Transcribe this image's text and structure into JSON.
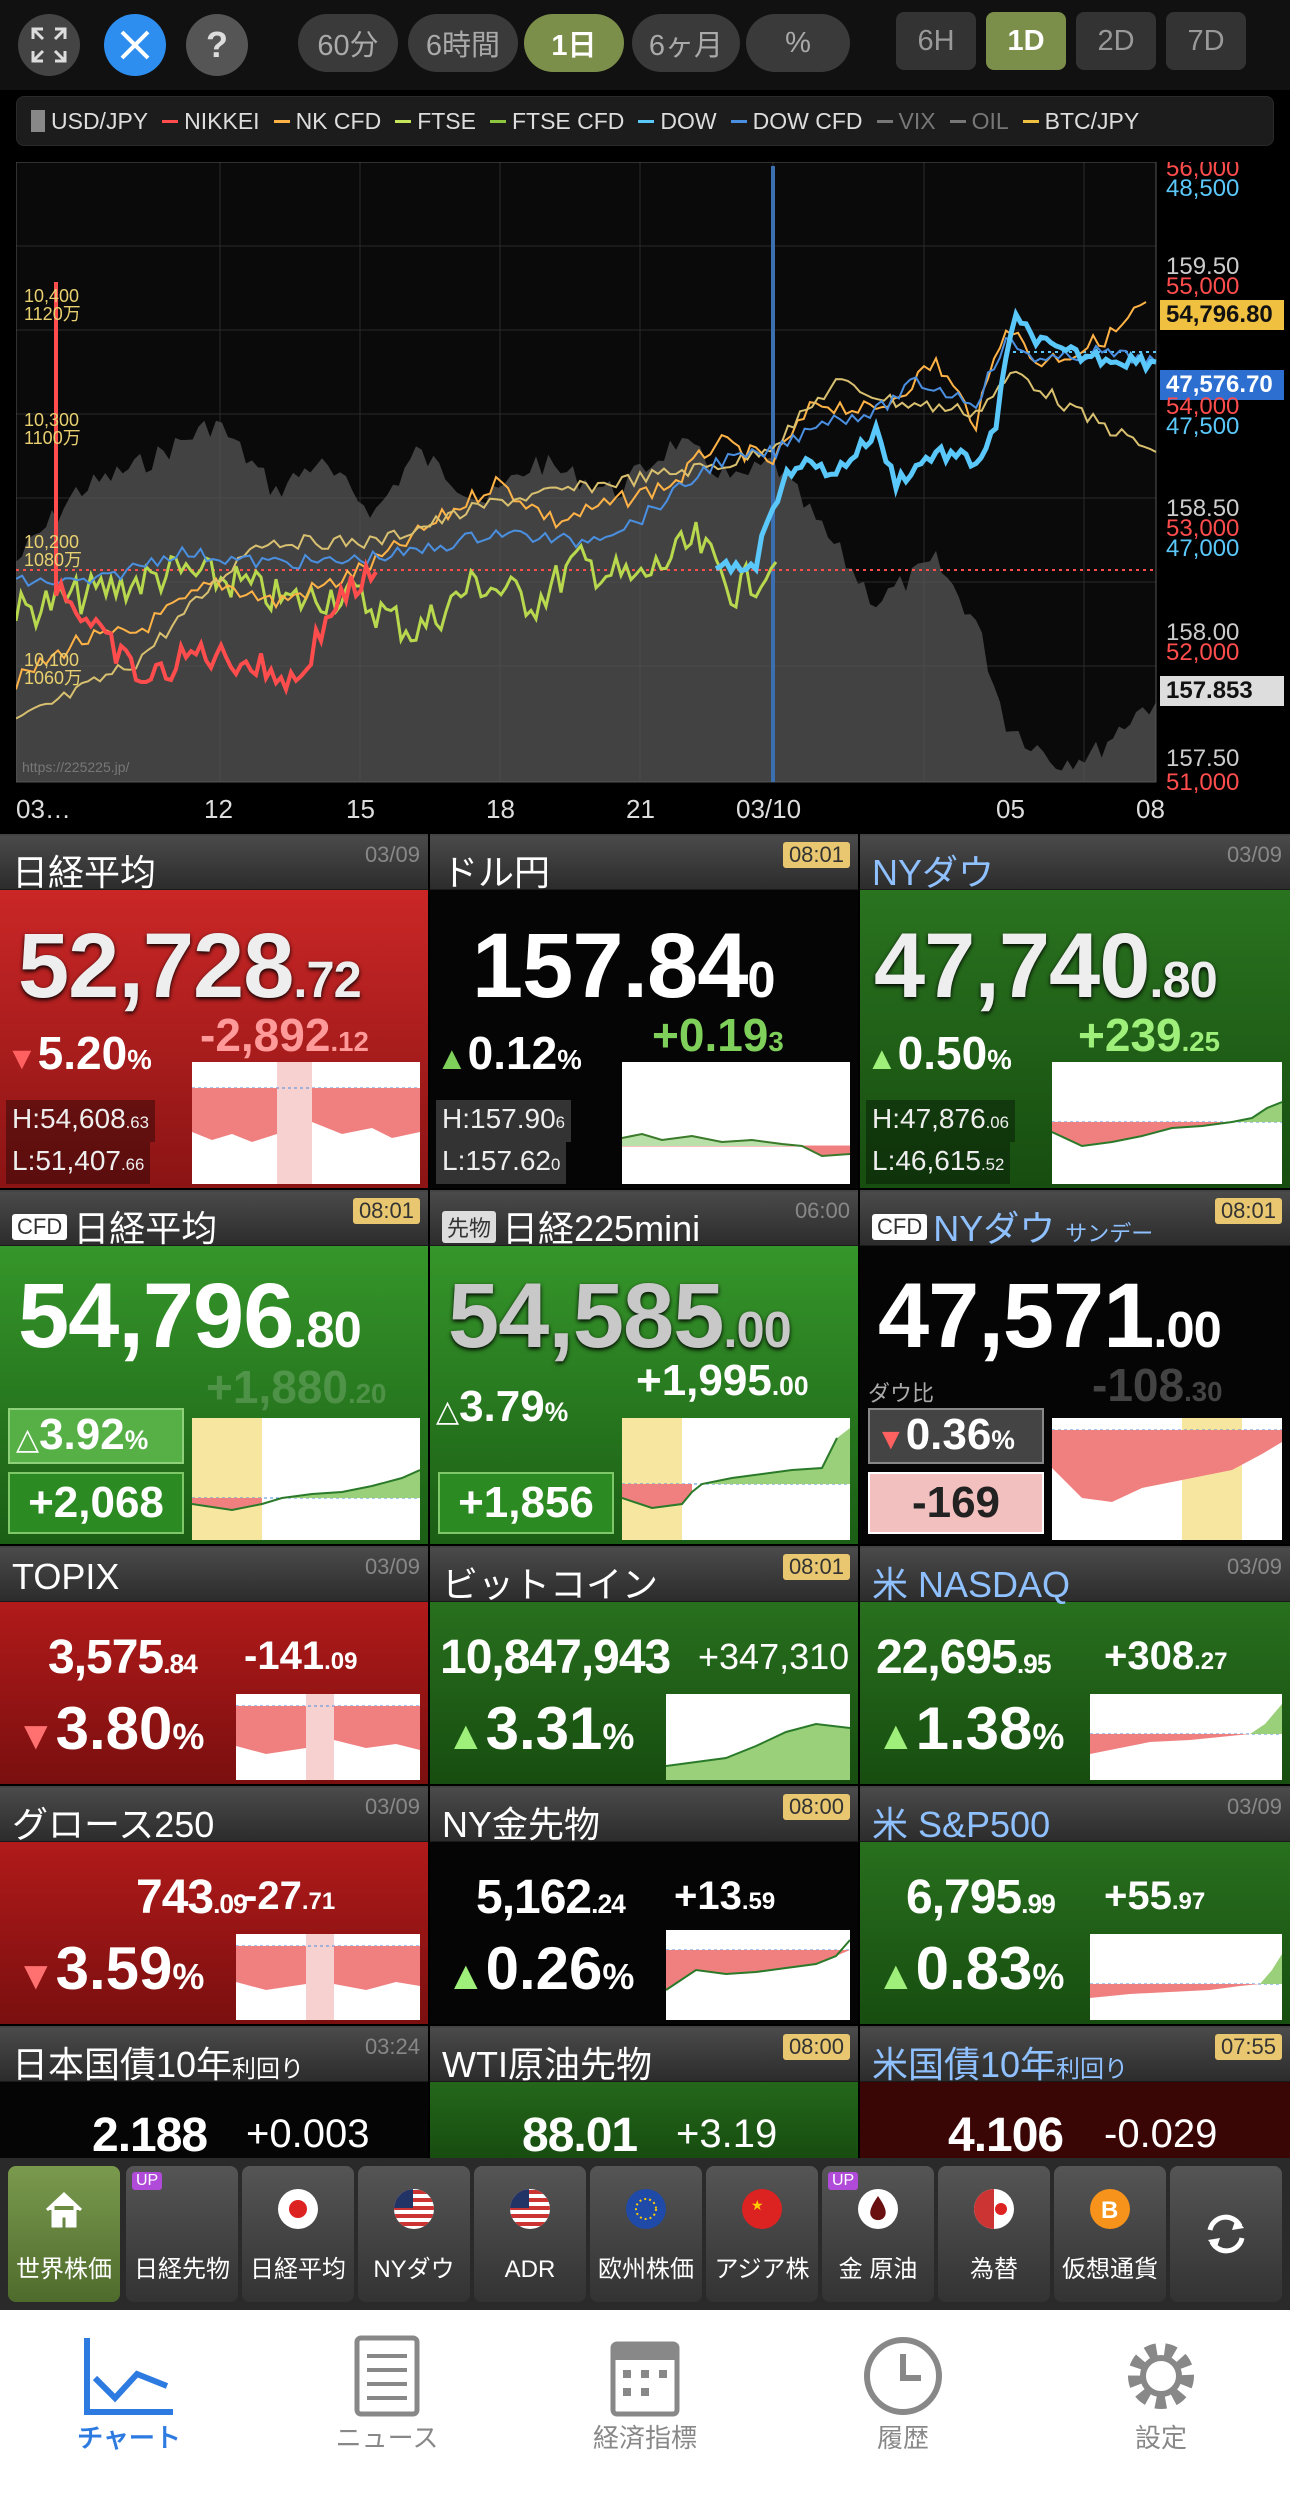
{
  "toolbar": {
    "ranges": [
      "60分",
      "6時間",
      "1日",
      "6ヶ月",
      "%"
    ],
    "active_range": "1日",
    "periods": [
      "6H",
      "1D",
      "2D",
      "7D"
    ],
    "active_period": "1D"
  },
  "legend": [
    {
      "label": "USD/JPY",
      "color": "#888888"
    },
    {
      "label": "NIKKEI",
      "color": "#ff4d4d"
    },
    {
      "label": "NK CFD",
      "color": "#ffb347"
    },
    {
      "label": "FTSE",
      "color": "#c5e65a"
    },
    {
      "label": "FTSE CFD",
      "color": "#8cc63f"
    },
    {
      "label": "DOW",
      "color": "#5ac8fa"
    },
    {
      "label": "DOW CFD",
      "color": "#4a8fe0"
    },
    {
      "label": "VIX",
      "color": "#777777"
    },
    {
      "label": "OIL",
      "color": "#777777"
    },
    {
      "label": "BTC/JPY",
      "color": "#f0c040"
    }
  ],
  "chart_data": {
    "type": "line",
    "x_labels": [
      "03…",
      "12",
      "15",
      "18",
      "21",
      "03/10",
      "05",
      "08"
    ],
    "right_axis": [
      "56,000",
      "48,500",
      "159.50",
      "55,000",
      "54,796.80",
      "47,576.70",
      "54,000",
      "47,500",
      "158.50",
      "53,000",
      "47,000",
      "158.00",
      "52,000",
      "157.853",
      "157.50",
      "51,000"
    ],
    "left_axis": [
      [
        "10,400",
        "1120万"
      ],
      [
        "10,300",
        "1100万"
      ],
      [
        "10,200",
        "1080万"
      ],
      [
        "10,100",
        "1060万"
      ]
    ],
    "watermark": "https://225225.jp/",
    "series": [
      {
        "name": "NK CFD",
        "values": [
          53400,
          53000,
          53100,
          53300,
          53500,
          53600,
          53400,
          53300,
          53700,
          53500,
          53900,
          54100,
          54000,
          54200,
          54000,
          54300,
          54800,
          54700,
          54790
        ]
      },
      {
        "name": "DOW CFD",
        "values": [
          47100,
          46900,
          46950,
          47000,
          47050,
          47100,
          47000,
          46950,
          47150,
          47100,
          47300,
          47400,
          47350,
          47500,
          47400,
          47600,
          47700,
          47600,
          47580
        ]
      },
      {
        "name": "USD/JPY",
        "values": [
          158.2,
          158.5,
          158.7,
          158.6,
          158.4,
          158.5,
          158.3,
          158.1,
          158.3,
          158.6,
          158.8,
          158.7,
          158.5,
          158.3,
          157.9,
          157.7,
          157.6,
          157.7,
          157.85
        ]
      },
      {
        "name": "NIKKEI",
        "values": [
          53500,
          52100,
          51900,
          52100,
          52300,
          52800
        ]
      }
    ]
  },
  "tiles": {
    "nikkei": {
      "name": "日経平均",
      "time": "03/09",
      "int": "52,728",
      "dec": ".72",
      "chg_int": "-2,892",
      "chg_dec": ".12",
      "pct": "5.20",
      "high": "54,608",
      "high_dec": ".63",
      "low": "51,407",
      "low_dec": ".66"
    },
    "usdjpy": {
      "name": "ドル円",
      "time": "08:01",
      "int": "157.84",
      "dec": "0",
      "chg_int": "+0.19",
      "chg_dec": "3",
      "pct": "0.12",
      "high": "157.90",
      "high_dec": "6",
      "low": "157.62",
      "low_dec": "0"
    },
    "dow": {
      "name": "NYダウ",
      "time": "03/09",
      "int": "47,740",
      "dec": ".80",
      "chg_int": "+239",
      "chg_dec": ".25",
      "pct": "0.50",
      "high": "47,876",
      "high_dec": ".06",
      "low": "46,615",
      "low_dec": ".52"
    },
    "cfd_nikkei": {
      "tag": "CFD",
      "name": "日経平均",
      "time": "08:01",
      "int": "54,796",
      "dec": ".80",
      "ghost": "+1,880",
      "ghost_dec": ".20",
      "pct": "3.92",
      "box": "+2,068"
    },
    "mini225": {
      "tag": "先物",
      "name": "日経225mini",
      "time": "06:00",
      "int": "54,585",
      "dec": ".00",
      "chg_int": "+1,995",
      "chg_dec": ".00",
      "pct": "3.79",
      "box": "+1,856"
    },
    "cfd_dow": {
      "tag": "CFD",
      "name": "NYダウ",
      "sub": "サンデー",
      "time": "08:01",
      "int": "47,571",
      "dec": ".00",
      "ghost": "-108",
      "ghost_dec": ".30",
      "dowhi": "ダウ比",
      "pct": "0.36",
      "box": "-169"
    },
    "topix": {
      "name": "TOPIX",
      "time": "03/09",
      "int": "3,575",
      "dec": ".84",
      "chg_int": "-141",
      "chg_dec": ".09",
      "pct": "3.80"
    },
    "btc": {
      "name": "ビットコイン",
      "time": "08:01",
      "int": "10,847,943",
      "chg_int": "+347,310",
      "pct": "3.31"
    },
    "nasdaq": {
      "name": "米 NASDAQ",
      "time": "03/09",
      "int": "22,695",
      "dec": ".95",
      "chg_int": "+308",
      "chg_dec": ".27",
      "pct": "1.38"
    },
    "growth": {
      "name": "グロース250",
      "time": "03/09",
      "int": "743",
      "dec": ".09",
      "chg_int": "-27",
      "chg_dec": ".71",
      "pct": "3.59"
    },
    "gold": {
      "name": "NY金先物",
      "time": "08:00",
      "int": "5,162",
      "dec": ".24",
      "chg_int": "+13",
      "chg_dec": ".59",
      "pct": "0.26"
    },
    "sp500": {
      "name": "米 S&P500",
      "time": "03/09",
      "int": "6,795",
      "dec": ".99",
      "chg_int": "+55",
      "chg_dec": ".97",
      "pct": "0.83"
    },
    "jgb": {
      "name": "日本国債10年",
      "sub": "利回り",
      "time": "03:24",
      "int": "2.188",
      "chg_int": "+0.003"
    },
    "wti": {
      "name": "WTI原油先物",
      "time": "08:00",
      "int": "88.01",
      "chg_int": "+3.19"
    },
    "ust": {
      "name": "米国債10年",
      "sub": "利回り",
      "time": "07:55",
      "int": "4.106",
      "chg_int": "-0.029"
    }
  },
  "nav": [
    {
      "label": "世界株価",
      "icon": "home-icon"
    },
    {
      "label": "日経先物",
      "icon": "up-badge",
      "up": "UP"
    },
    {
      "label": "日経平均",
      "icon": "japan-flag"
    },
    {
      "label": "NYダウ",
      "icon": "us-flag"
    },
    {
      "label": "ADR",
      "icon": "us-flag"
    },
    {
      "label": "欧州株価",
      "icon": "eu-flag"
    },
    {
      "label": "アジア株",
      "icon": "china-flag"
    },
    {
      "label": "金 原油",
      "icon": "oil-drop",
      "up": "UP"
    },
    {
      "label": "為替",
      "icon": "fx-flag"
    },
    {
      "label": "仮想通貨",
      "icon": "bitcoin-icon"
    }
  ],
  "tabs": [
    {
      "label": "チャート",
      "icon": "chart-icon"
    },
    {
      "label": "ニュース",
      "icon": "news-icon"
    },
    {
      "label": "経済指標",
      "icon": "calendar-icon"
    },
    {
      "label": "履歴",
      "icon": "clock-icon"
    },
    {
      "label": "設定",
      "icon": "gear-icon"
    }
  ]
}
